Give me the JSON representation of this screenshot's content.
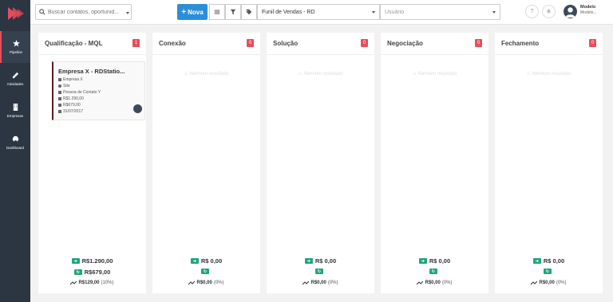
{
  "search": {
    "placeholder": "Buscar contatos, oportunid..."
  },
  "toolbar": {
    "nova_label": "Nova",
    "funnel_value": "Funil de Vendas - RD",
    "user_placeholder": "Usuário"
  },
  "user": {
    "name": "Modelo",
    "sub": "Modelo..."
  },
  "sidebar": {
    "items": [
      {
        "label": "Pipeline",
        "icon": "star-icon"
      },
      {
        "label": "Atividades",
        "icon": "pencil-icon"
      },
      {
        "label": "Empresas",
        "icon": "building-icon"
      },
      {
        "label": "Dashboard",
        "icon": "car-icon"
      }
    ]
  },
  "empty_text": "Nenhum resultado",
  "columns": [
    {
      "title": "Qualificação - MQL",
      "count": "1",
      "total1": "R$1.290,00",
      "total2": "R$679,00",
      "trend": "R$129,00",
      "trend_pct": "(10%)",
      "cards": [
        {
          "title": "Empresa X - RDStatio...",
          "company": "Empresa X",
          "source": "Site",
          "contact": "Pessoa de Contato Y",
          "value1": "R$1.290,00",
          "value2": "R$679,00",
          "date": "31/07/2017"
        }
      ]
    },
    {
      "title": "Conexão",
      "count": "0",
      "total1": "R$ 0,00",
      "total2": "",
      "trend": "R$0,00",
      "trend_pct": "(0%)"
    },
    {
      "title": "Solução",
      "count": "0",
      "total1": "R$ 0,00",
      "total2": "",
      "trend": "R$0,00",
      "trend_pct": "(0%)"
    },
    {
      "title": "Negociação",
      "count": "0",
      "total1": "R$ 0,00",
      "total2": "",
      "trend": "R$0,00",
      "trend_pct": "(0%)"
    },
    {
      "title": "Fechamento",
      "count": "0",
      "total1": "R$ 0,00",
      "total2": "",
      "trend": "R$0,00",
      "trend_pct": "(0%)"
    }
  ],
  "colors": {
    "brand_red": "#e84c5a",
    "primary_blue": "#2b8fd8",
    "success_green": "#1fa67a",
    "sidebar_bg": "#2c3542"
  }
}
